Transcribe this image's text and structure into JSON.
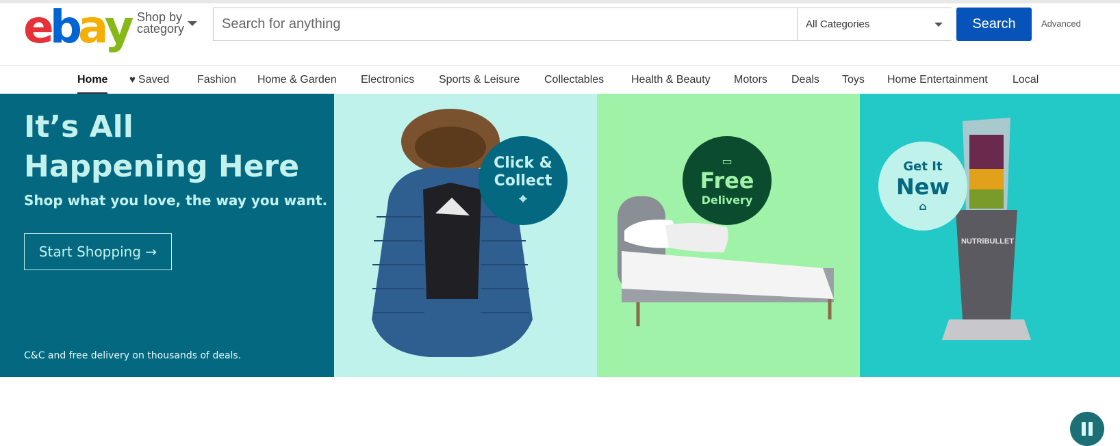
{
  "header": {
    "logo_letters": [
      {
        "char": "e",
        "color": "#e53238"
      },
      {
        "char": "b",
        "color": "#0064d2"
      },
      {
        "char": "a",
        "color": "#f5af02"
      },
      {
        "char": "y",
        "color": "#86b817"
      }
    ],
    "shop_by_line1": "Shop by",
    "shop_by_line2": "category",
    "search_placeholder": "Search for anything",
    "category_value": "All Categories",
    "search_button": "Search",
    "advanced_link": "Advanced"
  },
  "nav": {
    "items": [
      {
        "label": "Home",
        "active": true
      },
      {
        "label": "Saved",
        "icon": "heart-icon"
      },
      {
        "label": "Fashion"
      },
      {
        "label": "Home & Garden"
      },
      {
        "label": "Electronics"
      },
      {
        "label": "Sports & Leisure"
      },
      {
        "label": "Collectables"
      },
      {
        "label": "Health & Beauty"
      },
      {
        "label": "Motors"
      },
      {
        "label": "Deals"
      },
      {
        "label": "Toys"
      },
      {
        "label": "Home Entertainment"
      },
      {
        "label": "Local"
      }
    ]
  },
  "hero": {
    "title": "It’s All Happening Here",
    "subtitle": "Shop what you love, the way you want.",
    "cta": "Start Shopping →",
    "footnote": "C&C and free delivery on thousands of deals.",
    "badges": {
      "click_collect_line1": "Click &",
      "click_collect_line2": "Collect",
      "free": "Free",
      "delivery": "Delivery",
      "get_it": "Get It",
      "new": "New"
    },
    "product_brand": "NUTRiBULLET",
    "colors": {
      "panel_dark": "#036880",
      "panel_mint": "#bff2ea",
      "panel_green": "#a0f2a8",
      "panel_teal": "#23c9c7",
      "accent_text": "#c3f2ee"
    }
  }
}
